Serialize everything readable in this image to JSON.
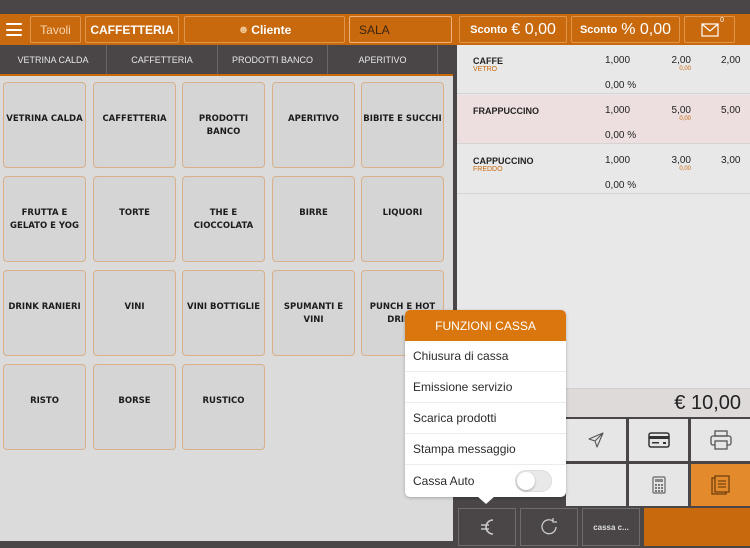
{
  "header": {
    "tavoli_label": "Tavoli",
    "category_label": "CAFFETTERIA",
    "cliente_label": "Cliente",
    "sala_value": "SALA",
    "sconto_euro_label": "Sconto",
    "sconto_euro_value": "€ 0,00",
    "sconto_pct_label": "Sconto",
    "sconto_pct_value": "% 0,00",
    "mail_badge": "0"
  },
  "tabs": [
    "VETRINA CALDA",
    "CAFFETTERIA",
    "PRODOTTI BANCO",
    "APERITIVO"
  ],
  "categories": [
    "VETRINA CALDA",
    "CAFFETTERIA",
    "PRODOTTI BANCO",
    "APERITIVO",
    "BIBITE E SUCCHI",
    "FRUTTA E GELATO E YOG",
    "TORTE",
    "THE E CIOCCOLATA",
    "BIRRE",
    "LIQUORI",
    "DRINK RANIERI",
    "VINI",
    "VINI BOTTIGLIE",
    "SPUMANTI E VINI",
    "PUNCH E HOT DRINK",
    "RISTO",
    "BORSE",
    "RUSTICO"
  ],
  "receipt": {
    "rows": [
      {
        "name": "CAFFE",
        "variant": "VETRO",
        "qty": "1,000",
        "price": "2,00",
        "price_discount": "0,00",
        "total": "2,00",
        "discount_pct": "0,00 %",
        "selected": false
      },
      {
        "name": "FRAPPUCCINO",
        "variant": "",
        "qty": "1,000",
        "price": "5,00",
        "price_discount": "0,00",
        "total": "5,00",
        "discount_pct": "0,00 %",
        "selected": true
      },
      {
        "name": "CAPPUCCINO",
        "variant": "FREDDO",
        "qty": "1,000",
        "price": "3,00",
        "price_discount": "0,00",
        "total": "3,00",
        "discount_pct": "0,00 %",
        "selected": false
      }
    ],
    "total": "€ 10,00"
  },
  "popover": {
    "title": "FUNZIONI CASSA",
    "items": [
      "Chiusura di cassa",
      "Emissione servizio",
      "Scarica prodotti",
      "Stampa messaggio",
      "Cassa Auto"
    ],
    "cassa_auto_enabled": false
  },
  "bottom_bar": {
    "cassa_label": "cassa c..."
  },
  "icons": {
    "menu": "hamburger-icon",
    "cliente": "person-icon",
    "mail": "envelope-icon",
    "send": "paper-plane-icon",
    "card": "credit-card-icon",
    "print": "printer-icon",
    "calc": "calculator-icon",
    "receipt": "document-icon",
    "euro": "euro-icon",
    "refresh": "refresh-icon"
  },
  "colors": {
    "accent": "#c8690e",
    "dark": "#4a4648",
    "popover_header": "#d9760e",
    "highlight_key": "#e38a2c"
  }
}
